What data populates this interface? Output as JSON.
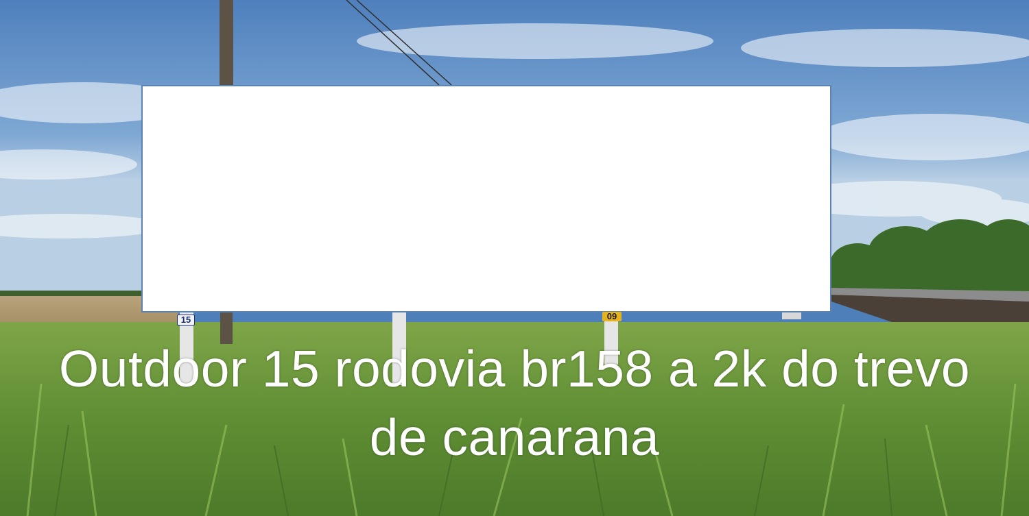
{
  "photo": {
    "caption": "Outdoor 15 rodovia br158 a 2k do trevo de canarana",
    "post_plates": {
      "left": "15",
      "right": "09"
    },
    "colors": {
      "sky": "#5f8fc6",
      "grass": "#6f9a3a",
      "billboard_panel": "#ffffff",
      "billboard_border": "#5b84b4"
    }
  }
}
